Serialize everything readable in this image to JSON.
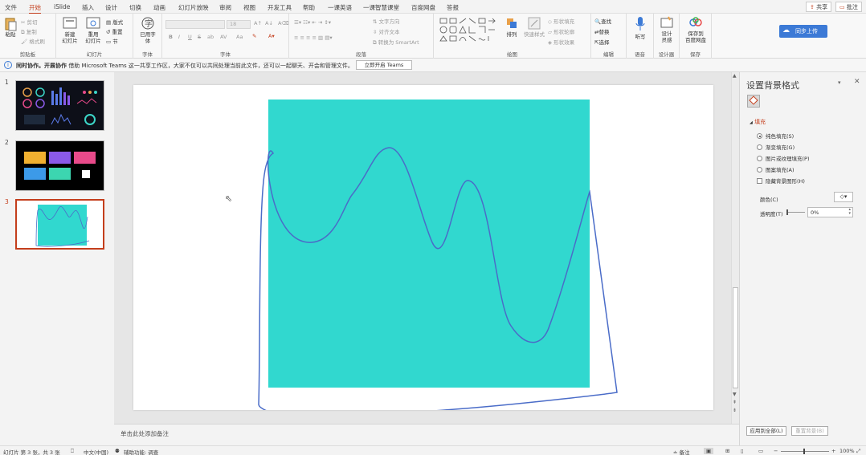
{
  "menu": {
    "tabs": [
      "文件",
      "开始",
      "iSlide",
      "插入",
      "设计",
      "切换",
      "动画",
      "幻灯片放映",
      "审阅",
      "视图",
      "开发工具",
      "帮助",
      "一课英语",
      "一课智慧课堂",
      "百度网盘",
      "答报"
    ],
    "active_tab": "开始",
    "share_label": "共享",
    "comments_label": "批注"
  },
  "ribbon": {
    "clipboard": {
      "paste": "粘贴",
      "cut": "剪切",
      "copy": "复制",
      "format_painter": "格式刷",
      "label": "剪贴板"
    },
    "slides": {
      "new_slide": "新建\n幻灯片",
      "reuse": "重用\n幻灯片",
      "layout": "版式",
      "reset": "重置",
      "section": "节",
      "label": "幻灯片"
    },
    "font_group": {
      "used_fonts": "已用字\n体",
      "label": "字体"
    },
    "font": {
      "size": "18",
      "bold": "B",
      "italic": "I",
      "underline": "U",
      "strike": "S",
      "shadow": "ab",
      "spacing": "AV",
      "case": "Aa",
      "label": "字体"
    },
    "paragraph": {
      "text_direction": "文字方向",
      "align_text": "对齐文本",
      "smartart": "转换为 SmartArt",
      "label": "段落"
    },
    "drawing": {
      "arrange": "排列",
      "quick_styles": "快速样式",
      "shape_fill": "形状填充",
      "shape_outline": "形状轮廓",
      "shape_effects": "形状效果",
      "label": "绘图"
    },
    "editing": {
      "find": "查找",
      "replace": "替换",
      "select": "选择",
      "label": "编辑"
    },
    "voice": {
      "dictate": "听写",
      "label": "语音"
    },
    "designer": {
      "design_ideas": "设计\n灵感",
      "label": "设计器"
    },
    "save": {
      "save_to_baidu": "保存到\n百度网盘",
      "label": "保存"
    },
    "sync_button": "同步上传"
  },
  "infobar": {
    "bold_text": "同时协作。开展协作",
    "message": "借助 Microsoft Teams 这一共享工作区，大家不仅可以共同处理当前此文件，还可以一起聊天、开会和管理文件。",
    "button": "立即开启 Teams"
  },
  "thumbnails": [
    {
      "number": "1"
    },
    {
      "number": "2"
    },
    {
      "number": "3"
    }
  ],
  "slide": {
    "fill_color": "#31d8cf",
    "curve_color": "#4a6cc8"
  },
  "notes_placeholder": "单击此处添加备注",
  "pane": {
    "title": "设置背景格式",
    "section": "填充",
    "options": [
      "纯色填充(S)",
      "渐变填充(G)",
      "图片或纹理填充(P)",
      "图案填充(A)"
    ],
    "selected_option": "纯色填充(S)",
    "hide_graphics": "隐藏背景图形(H)",
    "color_label": "颜色(C)",
    "transparency_label": "透明度(T)",
    "transparency_value": "0%",
    "apply_all": "应用到全部(L)",
    "reset_bg": "重置背景(B)"
  },
  "status": {
    "slide_info": "幻灯片 第 3 张，共 3 张",
    "language": "中文(中国)",
    "accessibility": "辅助功能: 调查",
    "notes": "备注",
    "zoom": "100%"
  }
}
